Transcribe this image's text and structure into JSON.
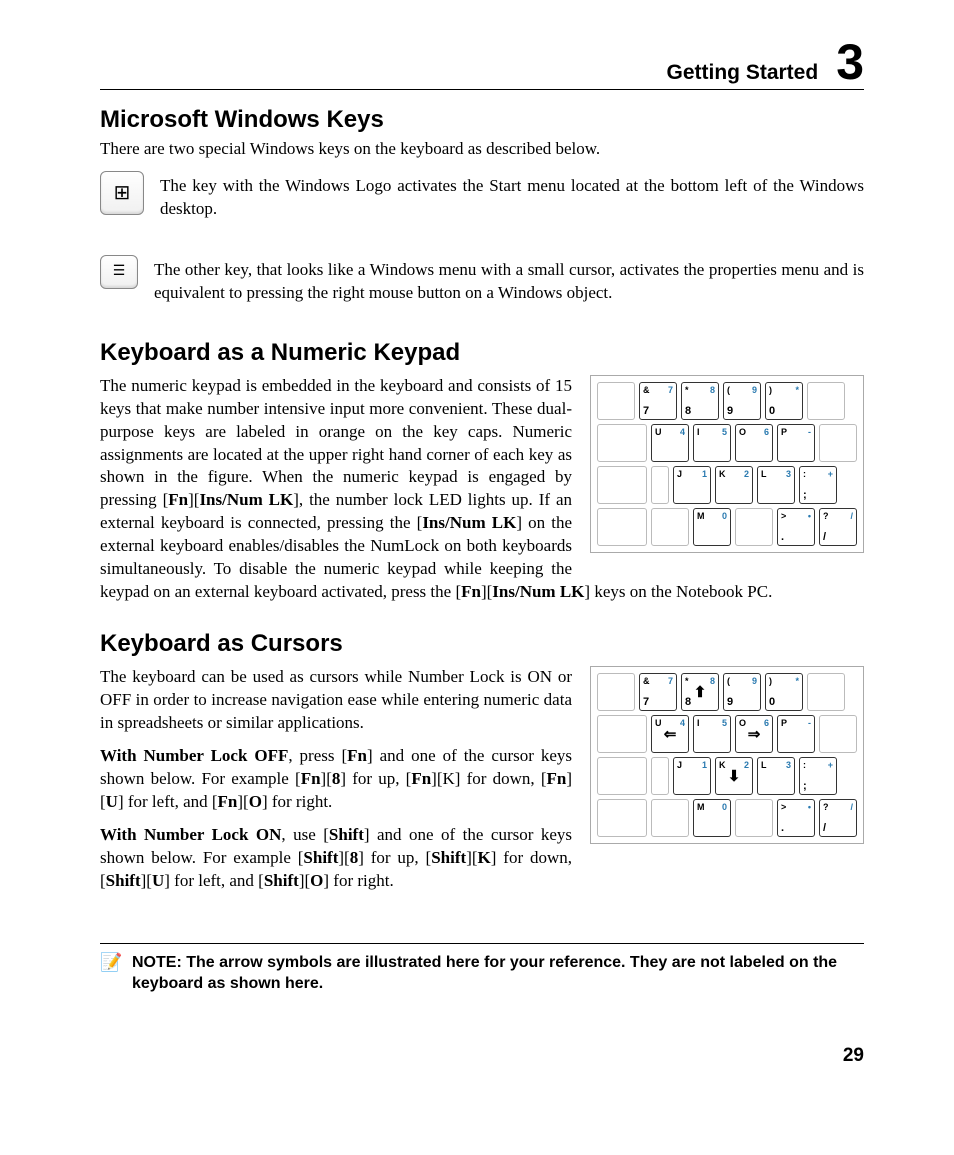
{
  "header": {
    "title": "Getting Started",
    "chapter": "3"
  },
  "s1": {
    "heading": "Microsoft Windows Keys",
    "intro": "There are two special Windows keys on the keyboard as described below.",
    "win_icon": "⊞",
    "win_text": "The key with the Windows Logo activates the Start menu located at the bottom left of the Windows desktop.",
    "menu_icon": "☰",
    "menu_text": "The other key, that looks like a Windows menu with a small cursor, activates the properties menu and is equivalent to pressing the right mouse button on a Windows object."
  },
  "s2": {
    "heading": "Keyboard as a Numeric Keypad",
    "p1a": "The numeric keypad is embedded in the keyboard and consists of 15 keys that make number intensive input more convenient. These dual-purpose keys are labeled in orange on the key caps. Numeric assignments are located at the upper right hand corner of each key as shown in the figure. When the numeric keypad is engaged by pressing [",
    "fn": "Fn",
    "brk1": "][",
    "ins": "Ins/Num LK",
    "p1b": "], the number lock LED lights up. If an external keyboard is connected, pressing the [",
    "p1c": "] on the external keyboard enables/disables the NumLock on both keyboards simultaneously. To disable the numeric keypad while keeping the keypad on an external keyboard activated, press the  [",
    "p1d": "] keys on the Notebook PC."
  },
  "s3": {
    "heading": "Keyboard as Cursors",
    "p1": "The keyboard can be used as cursors while Number Lock is ON or OFF in order to increase navigation ease while entering numeric data in spreadsheets or similar applications.",
    "nlo": "With Number Lock OFF",
    "p2a": ", press [",
    "p2b": "] and one of the cursor keys shown below. For example [",
    "p2c": "] for up, [",
    "p2d": "][K] for down, [",
    "p2e": "] for left, and [",
    "p2f": "] for right.",
    "fn": "Fn",
    "k8": "8",
    "ku": "U",
    "ko": "O",
    "nlon": "With Number Lock ON",
    "p3a": ", use [",
    "shift": "Shift",
    "p3b": "] and one of the cursor keys shown below. For example [",
    "kk": "K"
  },
  "arrows": {
    "up": "⬆",
    "down": "⬇",
    "left": "⇐",
    "right": "⇒"
  },
  "kbd": {
    "r1": [
      {
        "tl": "&",
        "tr": "7",
        "bl": "7"
      },
      {
        "tl": "*",
        "tr": "8",
        "bl": "8"
      },
      {
        "tl": "(",
        "tr": "9",
        "bl": "9"
      },
      {
        "tl": ")",
        "tr": "*",
        "bl": "0"
      }
    ],
    "r2": [
      {
        "tl": "U",
        "tr": "4"
      },
      {
        "tl": "I",
        "tr": "5"
      },
      {
        "tl": "O",
        "tr": "6"
      },
      {
        "tl": "P",
        "tr": "-"
      }
    ],
    "r3": [
      {
        "tl": "J",
        "tr": "1"
      },
      {
        "tl": "K",
        "tr": "2"
      },
      {
        "tl": "L",
        "tr": "3"
      },
      {
        "tl": ":",
        "tr": "+",
        "bl": ";"
      }
    ],
    "r4": [
      {
        "tl": "M",
        "tr": "0"
      },
      {
        "tl": ">",
        "tr": "•",
        "bl": "."
      },
      {
        "tl": "?",
        "tr": "/",
        "bl": "/"
      }
    ]
  },
  "note": {
    "icon": "📝",
    "text": "NOTE: The arrow symbols are illustrated here for your reference. They are not labeled on the keyboard as shown here."
  },
  "page_number": "29"
}
